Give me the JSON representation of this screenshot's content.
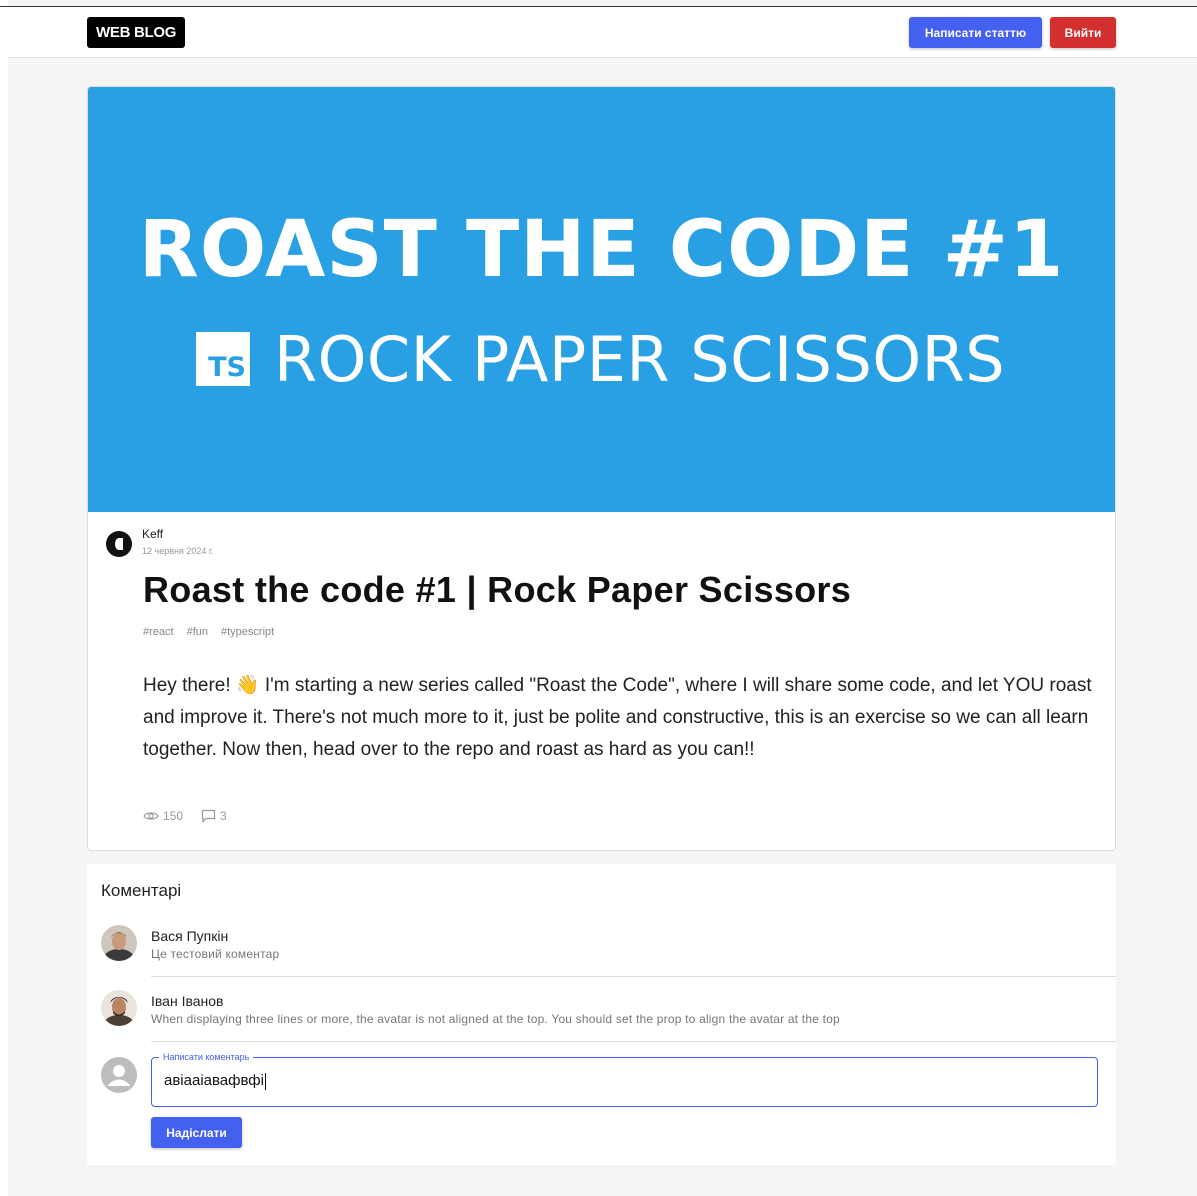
{
  "header": {
    "logo": "WEB BLOG",
    "write_button": "Написати статтю",
    "logout_button": "Вийти"
  },
  "post": {
    "banner": {
      "title": "ROAST THE CODE #1",
      "badge": "TS",
      "subtitle": "ROCK PAPER SCISSORS",
      "background": "#29a0e3"
    },
    "author": "Keff",
    "date": "12 червня 2024 г.",
    "title": "Roast the code #1 | Rock Paper Scissors",
    "tags": [
      "#react",
      "#fun",
      "#typescript"
    ],
    "body": "Hey there! 👋 I'm starting a new series called \"Roast the Code\", where I will share some code, and let YOU roast and improve it. There's not much more to it, just be polite and constructive, this is an exercise so we can all learn together. Now then, head over to the repo and roast as hard as you can!!",
    "views": "150",
    "comments_count": "3"
  },
  "comments": {
    "heading": "Коментарі",
    "items": [
      {
        "name": "Вася Пупкін",
        "text": "Це тестовий коментар"
      },
      {
        "name": "Іван Іванов",
        "text": "When displaying three lines or more, the avatar is not aligned at the top. You should set the prop to align the avatar at the top"
      }
    ],
    "input": {
      "label": "Написати коментарь",
      "value": "авіааіавафвфі"
    },
    "send_button": "Надіслати"
  },
  "colors": {
    "accent": "#4361ee",
    "danger": "#d32f2f"
  }
}
